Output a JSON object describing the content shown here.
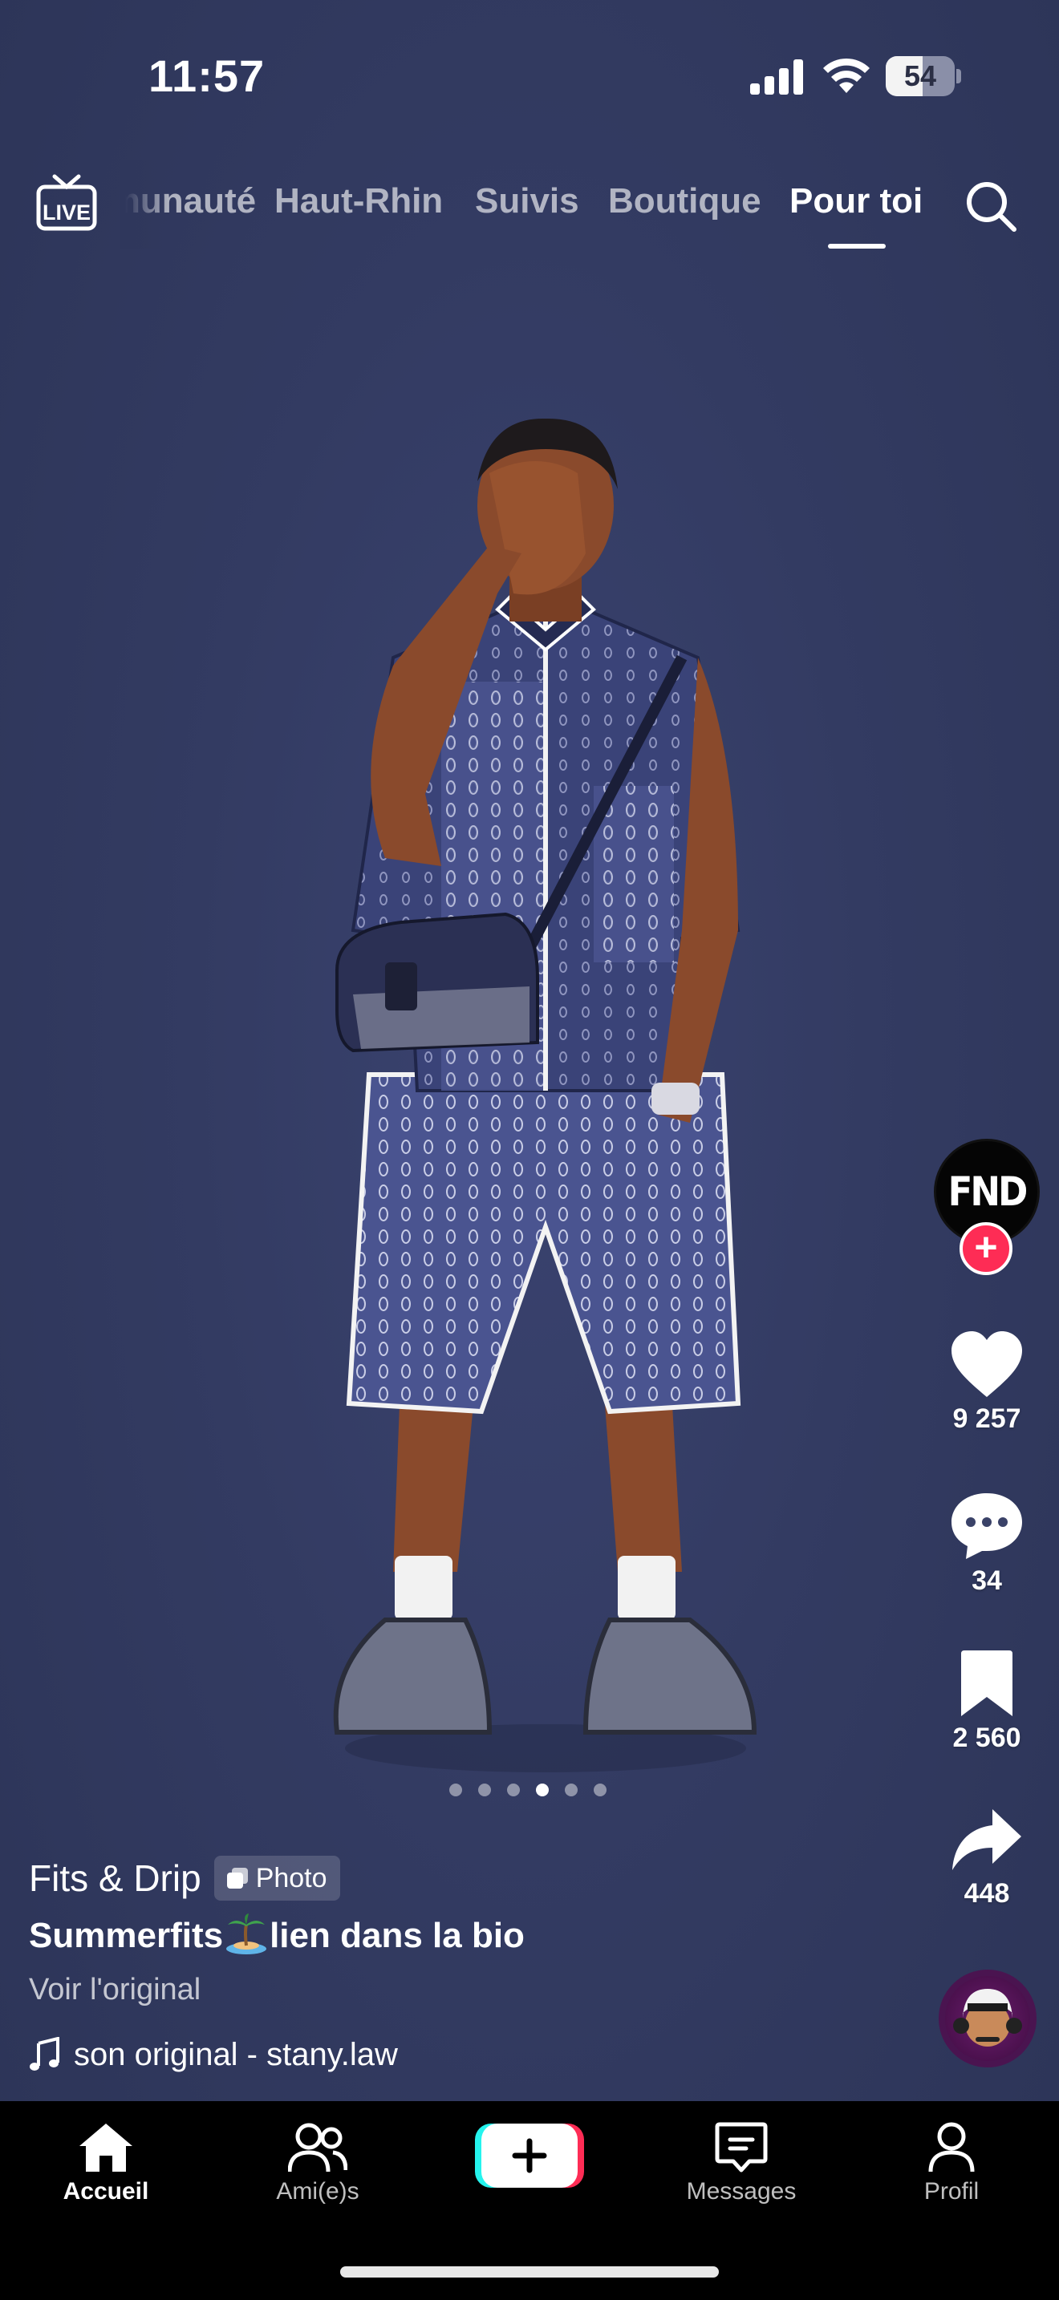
{
  "status_bar": {
    "time": "11:57",
    "battery_percent": "54",
    "battery_level": 0.54
  },
  "top_nav": {
    "live_label": "LIVE",
    "tabs": [
      {
        "label": "Communauté",
        "active": false
      },
      {
        "label": "Haut-Rhin",
        "active": false
      },
      {
        "label": "Suivis",
        "active": false
      },
      {
        "label": "Boutique",
        "active": false
      },
      {
        "label": "Pour toi",
        "active": true
      }
    ]
  },
  "post": {
    "pager": {
      "count": 6,
      "current_index": 3
    },
    "creator_avatar_text": "FND",
    "likes": "9 257",
    "comments": "34",
    "saves": "2 560",
    "shares": "448"
  },
  "caption": {
    "author": "Fits & Drip",
    "badge": "Photo",
    "text_before": "Summerfits",
    "text_after": "lien dans la bio",
    "see_original": "Voir l'original",
    "sound": "son original - stany.law"
  },
  "bottom_bar": {
    "items": [
      {
        "label": "Accueil",
        "icon": "home-icon",
        "active": true
      },
      {
        "label": "Ami(e)s",
        "icon": "friends-icon",
        "active": false
      },
      {
        "label": "",
        "icon": "plus-icon",
        "active": false
      },
      {
        "label": "Messages",
        "icon": "inbox-icon",
        "active": false
      },
      {
        "label": "Profil",
        "icon": "profile-icon",
        "active": false
      }
    ]
  },
  "colors": {
    "background": "#323a5e",
    "accent_red": "#fe2c55",
    "accent_cyan": "#25f4ee"
  }
}
